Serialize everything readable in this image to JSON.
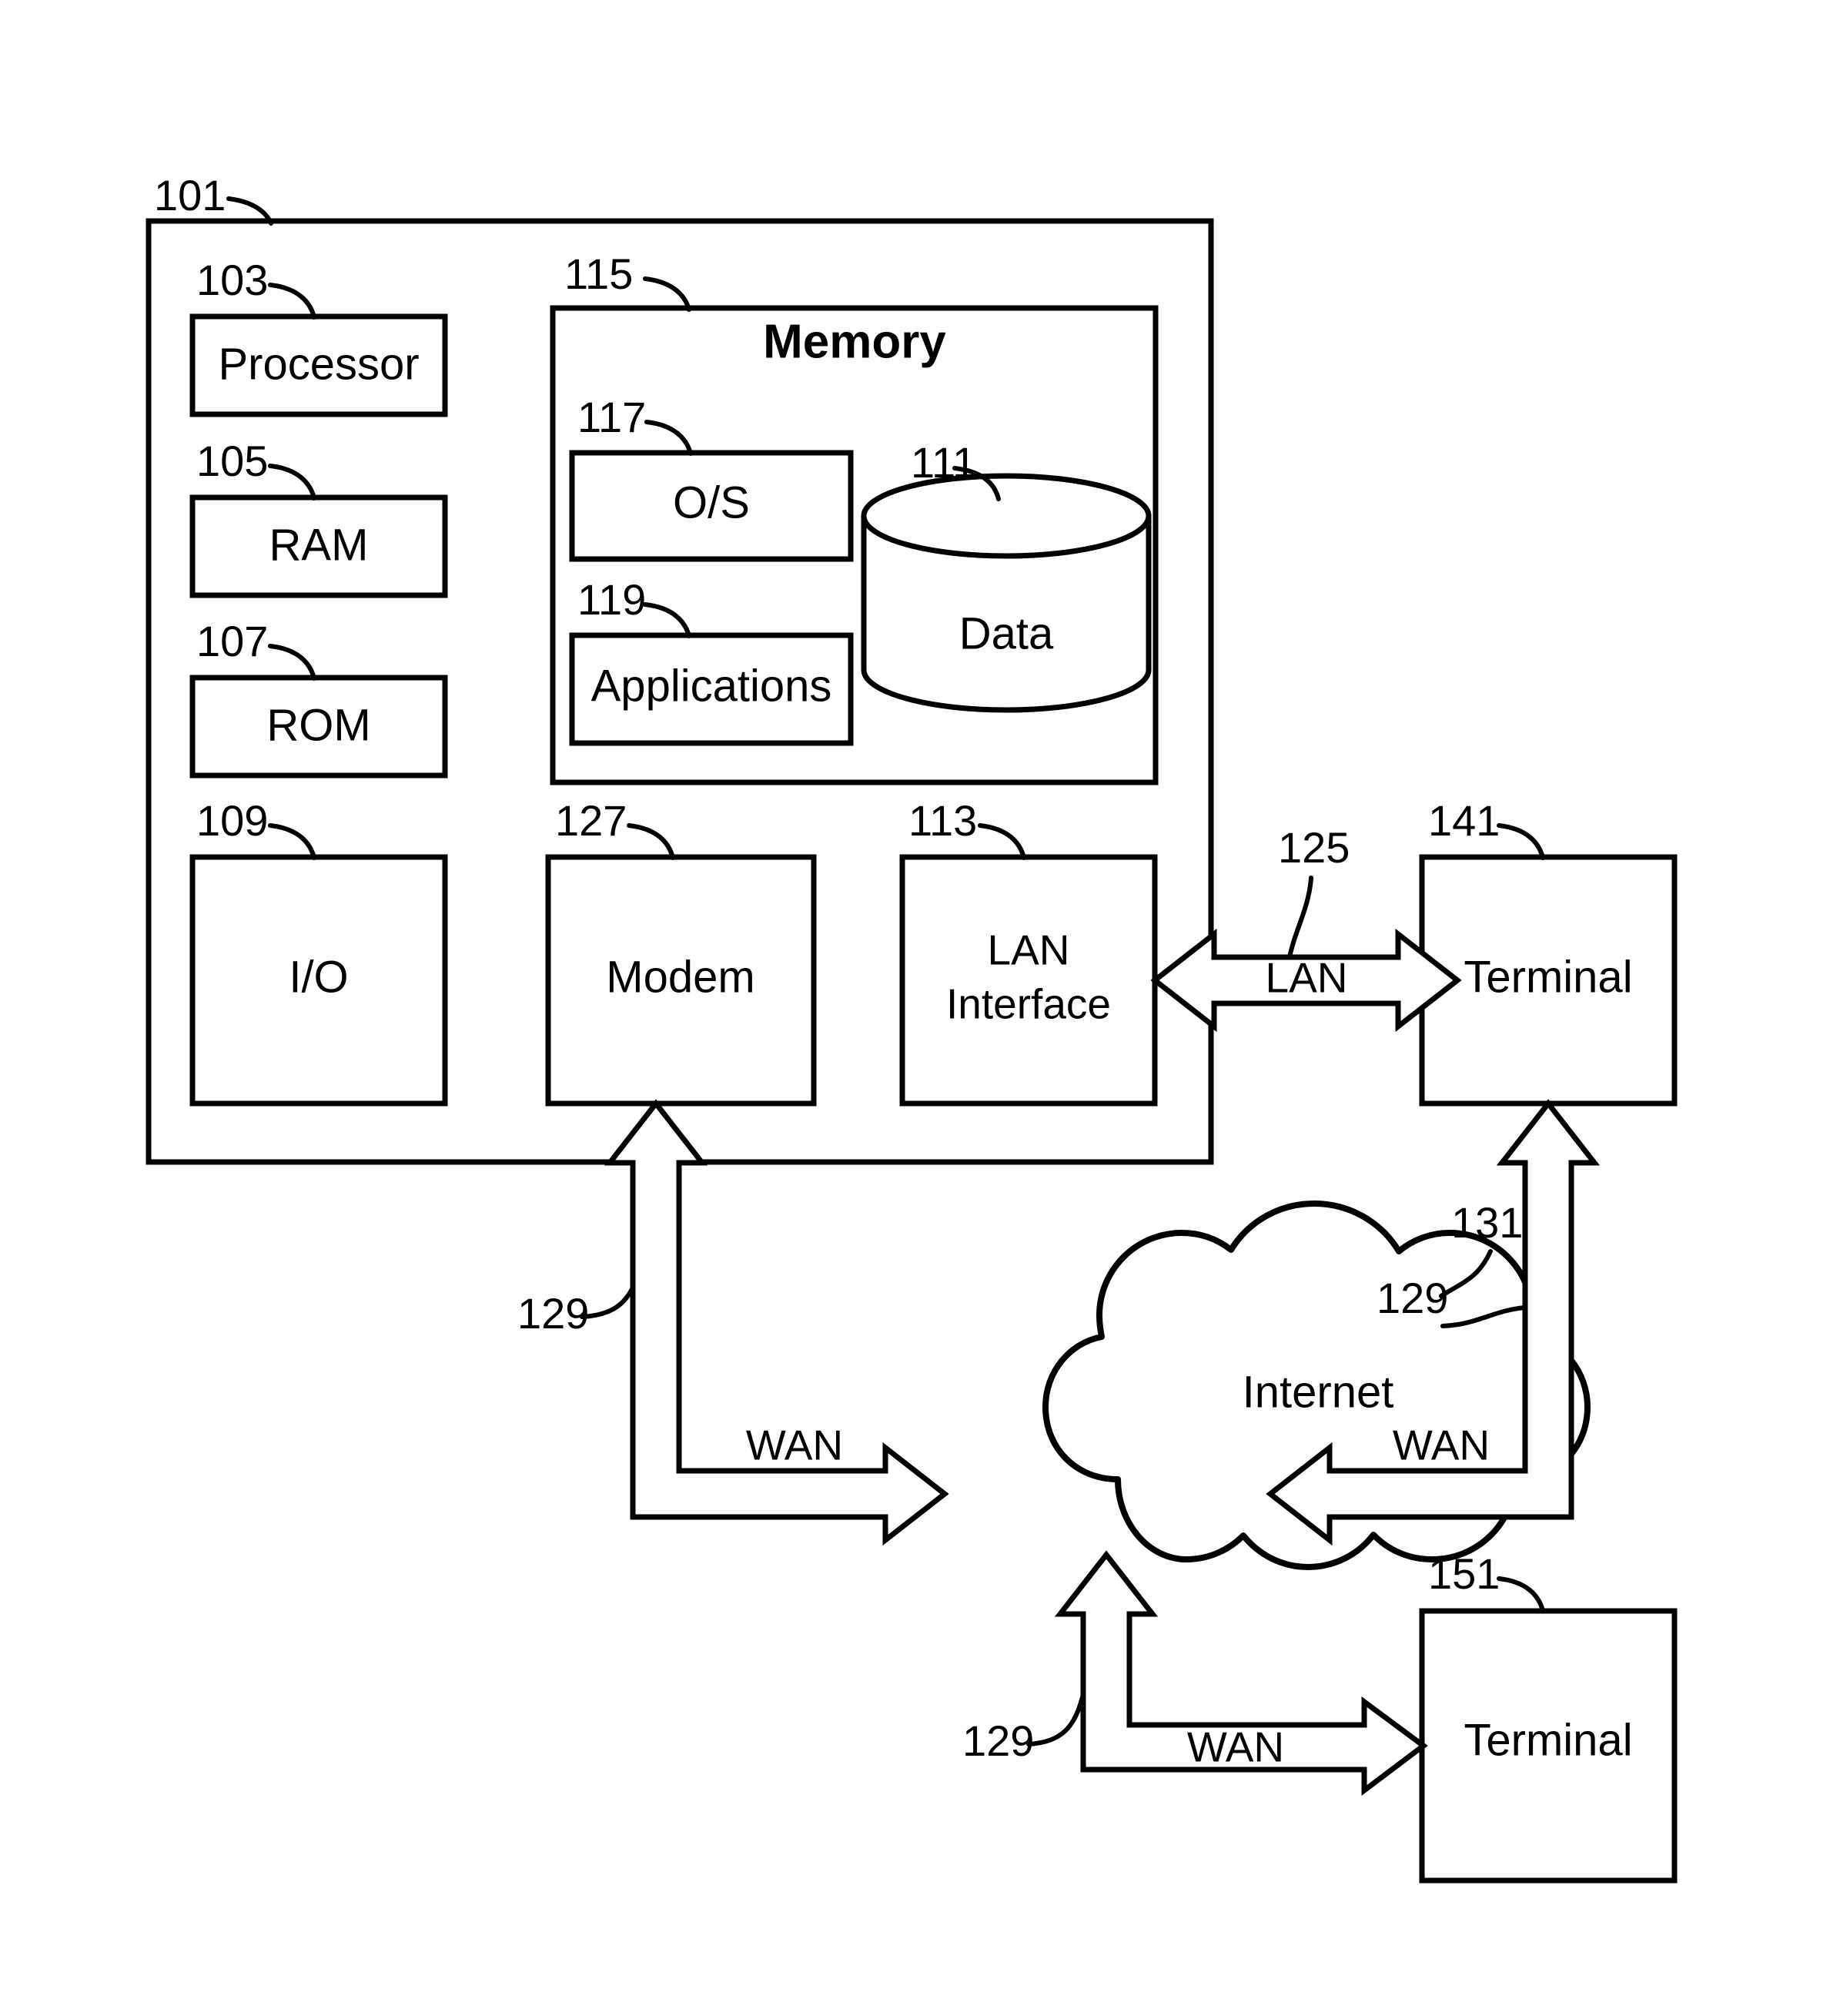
{
  "figure": {
    "title": "Computer system block diagram",
    "line_color": "#000000",
    "background": "#ffffff"
  },
  "blocks": {
    "system": {
      "ref": "101",
      "label": ""
    },
    "processor": {
      "ref": "103",
      "label": "Processor"
    },
    "ram": {
      "ref": "105",
      "label": "RAM"
    },
    "rom": {
      "ref": "107",
      "label": "ROM"
    },
    "io": {
      "ref": "109",
      "label": "I/O"
    },
    "memory": {
      "ref": "115",
      "label": "Memory"
    },
    "os": {
      "ref": "117",
      "label": "O/S"
    },
    "applications": {
      "ref": "119",
      "label": "Applications"
    },
    "data": {
      "ref": "111",
      "label": "Data"
    },
    "modem": {
      "ref": "127",
      "label": "Modem"
    },
    "lan_interface": {
      "ref": "113",
      "label_line1": "LAN",
      "label_line2": "Interface"
    },
    "terminal_lan": {
      "ref": "141",
      "label": "Terminal"
    },
    "terminal_wan": {
      "ref": "151",
      "label": "Terminal"
    },
    "internet": {
      "ref": "131",
      "label": "Internet"
    }
  },
  "links": {
    "lan": {
      "ref": "125",
      "label": "LAN"
    },
    "wan_modem": {
      "ref": "129",
      "label": "WAN"
    },
    "wan_terminal141": {
      "ref": "129",
      "label": "WAN"
    },
    "wan_terminal151": {
      "ref": "129",
      "label": "WAN"
    }
  }
}
